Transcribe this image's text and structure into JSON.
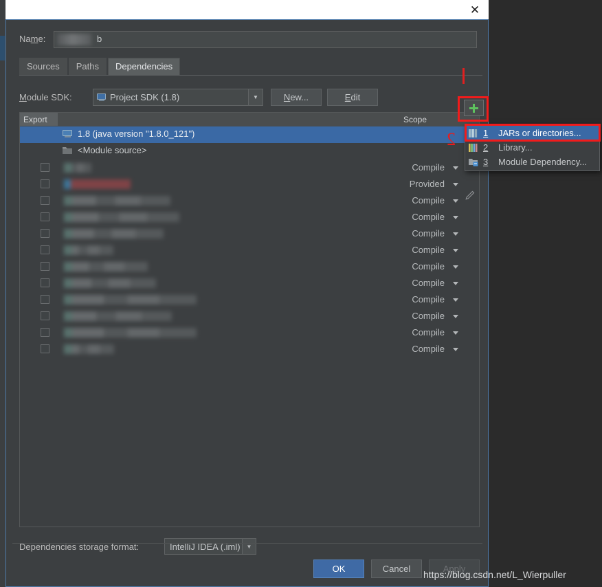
{
  "window": {
    "close_label": "✕"
  },
  "form": {
    "name_label_pre": "Na",
    "name_label_u": "m",
    "name_label_post": "e:",
    "name_value": "b",
    "name_placeholder": ""
  },
  "tabs": [
    {
      "label": "Sources",
      "active": false
    },
    {
      "label": "Paths",
      "active": false
    },
    {
      "label": "Dependencies",
      "active": true
    }
  ],
  "sdk": {
    "label_u": "M",
    "label_rest": "odule SDK:",
    "value": "Project SDK (1.8)",
    "arrow": "▼",
    "new_button_u": "N",
    "new_button_rest": "ew...",
    "edit_button_u": "E",
    "edit_button_rest": "dit"
  },
  "table": {
    "header_export": "Export",
    "header_scope": "Scope",
    "add_button_tooltip": "Add",
    "rows": [
      {
        "type": "sdk",
        "label": "1.8 (java version \"1.8.0_121\")",
        "selected": true,
        "checkbox": false,
        "scope": ""
      },
      {
        "type": "source",
        "label": "<Module source>",
        "selected": false,
        "checkbox": false,
        "scope": ""
      },
      {
        "type": "blur",
        "label": "",
        "blur_width": 40,
        "blur_red": false,
        "checkbox": true,
        "scope": "Compile"
      },
      {
        "type": "blur",
        "label": "",
        "blur_width": 97,
        "blur_red": true,
        "checkbox": true,
        "scope": "Provided"
      },
      {
        "type": "blur",
        "label": "",
        "blur_width": 155,
        "blur_red": false,
        "checkbox": true,
        "scope": "Compile"
      },
      {
        "type": "blur",
        "label": "",
        "blur_width": 168,
        "blur_red": false,
        "checkbox": true,
        "scope": "Compile"
      },
      {
        "type": "blur",
        "label": "",
        "blur_width": 145,
        "blur_red": false,
        "checkbox": true,
        "scope": "Compile"
      },
      {
        "type": "blur",
        "label": "",
        "blur_width": 72,
        "blur_red": false,
        "checkbox": true,
        "scope": "Compile"
      },
      {
        "type": "blur",
        "label": "",
        "blur_width": 122,
        "blur_red": false,
        "checkbox": true,
        "scope": "Compile"
      },
      {
        "type": "blur",
        "label": "",
        "blur_width": 134,
        "blur_red": false,
        "checkbox": true,
        "scope": "Compile"
      },
      {
        "type": "blur",
        "label": "",
        "blur_width": 193,
        "blur_red": false,
        "checkbox": true,
        "scope": "Compile"
      },
      {
        "type": "blur",
        "label": "",
        "blur_width": 157,
        "blur_red": false,
        "checkbox": true,
        "scope": "Compile"
      },
      {
        "type": "blur",
        "label": "",
        "blur_width": 193,
        "blur_red": false,
        "checkbox": true,
        "scope": "Compile"
      },
      {
        "type": "blur",
        "label": "",
        "blur_width": 73,
        "blur_red": false,
        "checkbox": true,
        "scope": "Compile"
      }
    ]
  },
  "context_menu": {
    "items": [
      {
        "num": "1",
        "label": "JARs or directories...",
        "icon": "jars-icon",
        "highlighted": true
      },
      {
        "num": "2",
        "label": "Library...",
        "icon": "library-icon",
        "highlighted": false
      },
      {
        "num": "3",
        "label": "Module Dependency...",
        "icon": "module-dep-icon",
        "highlighted": false
      }
    ]
  },
  "storage": {
    "label": "Dependencies storage format:",
    "value": "IntelliJ IDEA (.iml)",
    "arrow": "▼"
  },
  "footer": {
    "ok": "OK",
    "cancel": "Cancel",
    "apply": "Apply"
  },
  "watermark": "https://blog.csdn.net/L_Wierpuller",
  "colors": {
    "dialog_bg": "#3c3f41",
    "desktop_bg": "#2b2b2b",
    "selection_blue": "#3a69a5",
    "accent_green": "#5ec25e",
    "annotation_red": "#f21b1b",
    "primary_button": "#3f6aa5"
  }
}
